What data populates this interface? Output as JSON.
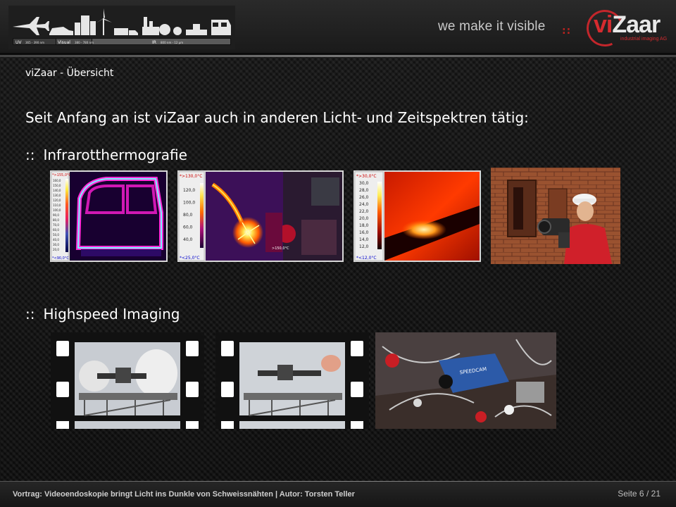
{
  "header": {
    "tagline": "we make it visible",
    "tagline_separator": "::",
    "logo": {
      "vi": "vi",
      "zaar": "Zaar",
      "subtitle": "industrial imaging AG"
    },
    "spectrum_bar": {
      "uv": "UV",
      "uv_range": "365 - 390 nm",
      "visual": "Visual",
      "visual_range": "380 - 780 nm",
      "ir": "IR",
      "ir_range": "800 nm - 12 µm"
    }
  },
  "slide": {
    "breadcrumb": "viZaar - Übersicht",
    "headline": "Seit Anfang an ist viZaar auch in anderen Licht- und Zeitspektren tätig:",
    "sections": [
      {
        "bullet": "::",
        "title": "Infrarotthermografie"
      },
      {
        "bullet": "::",
        "title": "Highspeed Imaging"
      }
    ]
  },
  "thermo_images": [
    {
      "top_label": "*>155,0°C",
      "bottom_label": "*<90,0°C",
      "scale": [
        "160,0",
        "150,0",
        "140,0",
        "130,0",
        "120,0",
        "110,0",
        "100,0",
        "90,0",
        "80,0",
        "70,0",
        "60,0",
        "50,0",
        "40,0",
        "30,0",
        "20,0"
      ]
    },
    {
      "top_label": "*>130,0°C",
      "bottom_label": "*<25,0°C",
      "scale": [
        "120,0",
        "100,0",
        "80,0",
        "60,0",
        "40,0"
      ],
      "spot": ">150,0°C"
    },
    {
      "top_label": "*>30,0°C",
      "bottom_label": "*<12,0°C",
      "scale": [
        "30,0",
        "28,0",
        "26,0",
        "24,0",
        "22,0",
        "20,0",
        "18,0",
        "16,0",
        "14,0",
        "12,0"
      ]
    }
  ],
  "colors": {
    "accent": "#c3262b",
    "text": "#ffffff"
  },
  "footer": {
    "talk": "Vortrag: Videoendoskopie bringt Licht ins Dunkle von Schweissnähten  |  Autor: Torsten Teller",
    "page_label": "Seite",
    "page_current": "6",
    "page_sep": "/",
    "page_total": "21"
  }
}
